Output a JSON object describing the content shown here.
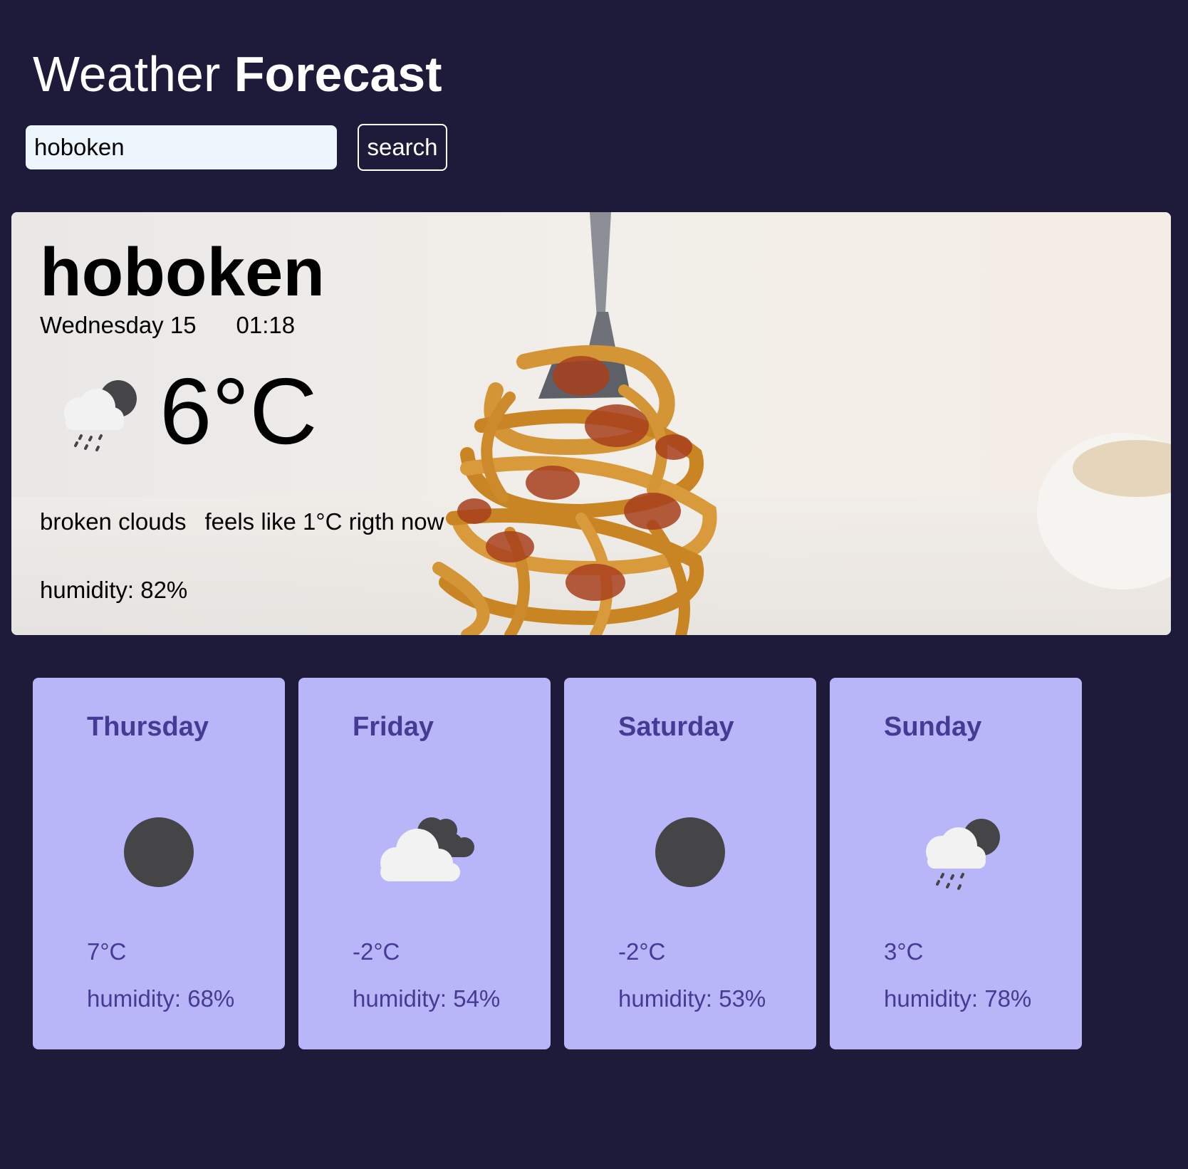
{
  "header": {
    "title_regular": "Weather",
    "title_bold": "Forecast"
  },
  "search": {
    "value": "hoboken",
    "button_label": "search"
  },
  "current": {
    "city": "hoboken",
    "date": "Wednesday 15",
    "time": "01:18",
    "temperature": "6°C",
    "icon": "rain-cloud-dark-moon-icon",
    "description": "broken clouds",
    "feels_like": "feels like 1°C rigth now",
    "humidity": "humidity: 82%",
    "background": "spaghetti-on-fork-photo"
  },
  "forecast": [
    {
      "day": "Thursday",
      "icon": "dark-circle-icon",
      "temperature": "7°C",
      "humidity": "humidity: 68%"
    },
    {
      "day": "Friday",
      "icon": "cloud-dark-clouds-icon",
      "temperature": "-2°C",
      "humidity": "humidity: 54%"
    },
    {
      "day": "Saturday",
      "icon": "dark-circle-icon",
      "temperature": "-2°C",
      "humidity": "humidity: 53%"
    },
    {
      "day": "Sunday",
      "icon": "rain-cloud-dark-moon-icon",
      "temperature": "3°C",
      "humidity": "humidity: 78%"
    }
  ],
  "colors": {
    "page_background": "#1e1a3a",
    "card_background": "#b8b5f8",
    "card_text": "#463b94",
    "input_background": "#eef6fd",
    "icon_dark": "#454548",
    "icon_cloud": "#f2f2f2"
  }
}
